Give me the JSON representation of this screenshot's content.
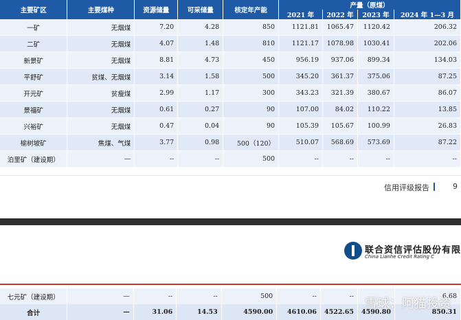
{
  "table": {
    "headers": [
      "主要矿区",
      "主要煤种",
      "资源储量",
      "可采储量",
      "核定年产能"
    ],
    "group_header": "产量（原煤）",
    "year_headers": [
      "2021 年",
      "2022 年",
      "2023 年",
      "2024 年 1—3 月"
    ],
    "rows": [
      {
        "name": "一矿",
        "type": "无烟煤",
        "resource": "7.20",
        "mineable": "4.28",
        "capacity": "850",
        "y2021": "1121.81",
        "y2022": "1065.47",
        "y2023": "1120.42",
        "y2024": "206.32"
      },
      {
        "name": "二矿",
        "type": "无烟煤",
        "resource": "4.07",
        "mineable": "1.48",
        "capacity": "810",
        "y2021": "1121.17",
        "y2022": "1078.98",
        "y2023": "1030.41",
        "y2024": "202.06"
      },
      {
        "name": "新景矿",
        "type": "无烟煤",
        "resource": "8.81",
        "mineable": "4.73",
        "capacity": "450",
        "y2021": "956.19",
        "y2022": "937.06",
        "y2023": "899.34",
        "y2024": "134.03"
      },
      {
        "name": "平舒矿",
        "type": "贫煤、无烟煤",
        "resource": "3.14",
        "mineable": "1.58",
        "capacity": "500",
        "y2021": "345.20",
        "y2022": "361.37",
        "y2023": "375.06",
        "y2024": "87.25"
      },
      {
        "name": "开元矿",
        "type": "贫瘦煤",
        "resource": "2.99",
        "mineable": "1.17",
        "capacity": "300",
        "y2021": "343.23",
        "y2022": "321.39",
        "y2023": "380.67",
        "y2024": "86.07"
      },
      {
        "name": "景福矿",
        "type": "无烟煤",
        "resource": "0.61",
        "mineable": "0.27",
        "capacity": "90",
        "y2021": "107.00",
        "y2022": "84.02",
        "y2023": "110.22",
        "y2024": "13.85"
      },
      {
        "name": "兴裕矿",
        "type": "无烟煤",
        "resource": "0.47",
        "mineable": "0.04",
        "capacity": "90",
        "y2021": "105.39",
        "y2022": "105.67",
        "y2023": "100.99",
        "y2024": "26.83"
      },
      {
        "name": "榆树坡矿",
        "type": "焦煤、气煤",
        "resource": "3.77",
        "mineable": "0.98",
        "capacity": "500（120）",
        "y2021": "510.07",
        "y2022": "568.69",
        "y2023": "573.69",
        "y2024": "87.22"
      },
      {
        "name": "泊里矿（建设期）",
        "type": "—",
        "resource": "--",
        "mineable": "--",
        "capacity": "500",
        "y2021": "--",
        "y2022": "--",
        "y2023": "--",
        "y2024": "--"
      }
    ],
    "bottom_rows": [
      {
        "name": "七元矿（建设期）",
        "type": "—",
        "resource": "--",
        "mineable": "--",
        "capacity": "500",
        "y2021": "--",
        "y2022": "--",
        "y2023": "",
        "y2024": "6.68"
      },
      {
        "name": "合计",
        "type": "—",
        "resource": "31.06",
        "mineable": "14.53",
        "capacity": "4590.00",
        "y2021": "4610.06",
        "y2022": "4522.65",
        "y2023": "4590.80",
        "y2024": "850.31"
      }
    ]
  },
  "footer": {
    "report_name": "信用评级报告",
    "page_number": "9"
  },
  "logo": {
    "cn": "联合资信评估股份有限",
    "en": "China Lianhe Credit Rating C"
  },
  "watermark": {
    "text": "雪球：阿猫投资"
  },
  "colors": {
    "header_bg": "#1e5aa5",
    "row_bg": "#edf1fa",
    "accent_red": "#c0392b"
  }
}
